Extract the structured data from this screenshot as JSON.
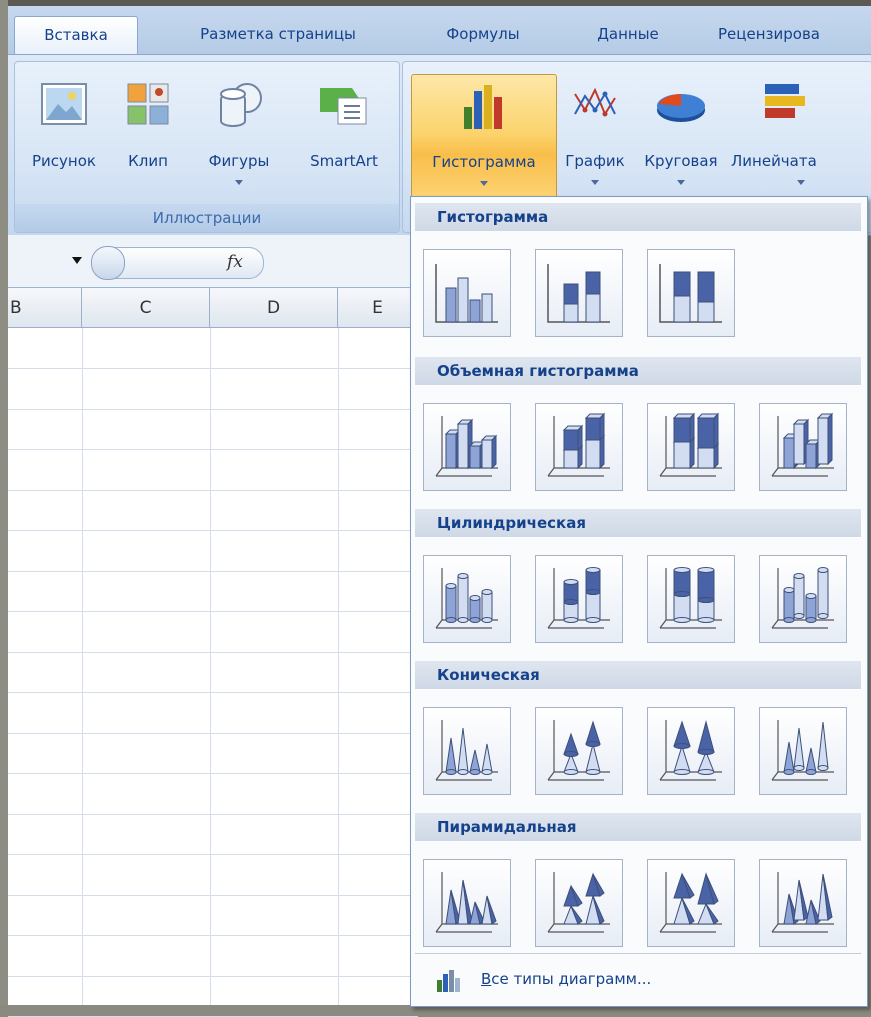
{
  "tabs": [
    {
      "label": "Вставка",
      "active": true
    },
    {
      "label": "Разметка страницы",
      "active": false
    },
    {
      "label": "Формулы",
      "active": false
    },
    {
      "label": "Данные",
      "active": false
    },
    {
      "label": "Рецензирова",
      "active": false
    }
  ],
  "ribbon": {
    "illustrations": {
      "group_label": "Иллюстрации",
      "buttons": [
        {
          "label": "Рисунок",
          "icon": "picture-icon"
        },
        {
          "label": "Клип",
          "icon": "clipart-icon"
        },
        {
          "label": "Фигуры",
          "icon": "shapes-icon"
        },
        {
          "label": "SmartArt",
          "icon": "smartart-icon"
        }
      ]
    },
    "charts": {
      "buttons": [
        {
          "label": "Гистограмма",
          "icon": "column-chart-icon",
          "active": true
        },
        {
          "label": "График",
          "icon": "line-chart-icon"
        },
        {
          "label": "Круговая",
          "icon": "pie-chart-icon"
        },
        {
          "label": "Линейчата",
          "icon": "bar-chart-icon"
        }
      ]
    }
  },
  "formula_bar": {
    "fx": "fx"
  },
  "grid": {
    "columns": [
      "B",
      "C",
      "D",
      "E"
    ]
  },
  "dropdown": {
    "sections": [
      {
        "title": "Гистограмма",
        "items": [
          "clustered-column-icon",
          "stacked-column-icon",
          "100-stacked-column-icon"
        ]
      },
      {
        "title": "Объемная гистограмма",
        "items": [
          "3d-clustered-column-icon",
          "3d-stacked-column-icon",
          "3d-100-stacked-column-icon",
          "3d-column-icon"
        ]
      },
      {
        "title": "Цилиндрическая",
        "items": [
          "clustered-cylinder-icon",
          "stacked-cylinder-icon",
          "100-stacked-cylinder-icon",
          "3d-cylinder-icon"
        ]
      },
      {
        "title": "Коническая",
        "items": [
          "clustered-cone-icon",
          "stacked-cone-icon",
          "100-stacked-cone-icon",
          "3d-cone-icon"
        ]
      },
      {
        "title": "Пирамидальная",
        "items": [
          "clustered-pyramid-icon",
          "stacked-pyramid-icon",
          "100-stacked-pyramid-icon",
          "3d-pyramid-icon"
        ]
      }
    ],
    "footer": {
      "label": "Все типы диаграмм...",
      "underline_char": "В",
      "rest": "се типы диаграмм..."
    }
  },
  "colors": {
    "ribbon": "#d0e0f3",
    "accent": "#15428b",
    "active_button": "#fbd36c"
  }
}
